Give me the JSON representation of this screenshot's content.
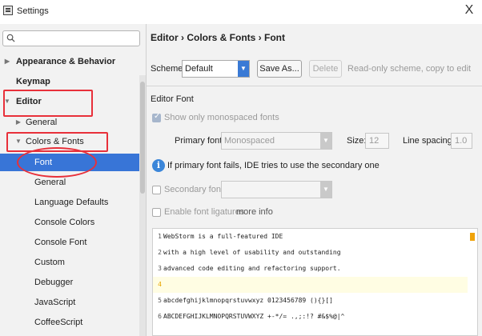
{
  "window": {
    "title": "Settings",
    "close_glyph": "X"
  },
  "search": {
    "placeholder": ""
  },
  "sidebar": {
    "items": [
      {
        "label": "Appearance & Behavior",
        "arrow": "▶"
      },
      {
        "label": "Keymap"
      },
      {
        "label": "Editor",
        "arrow": "▼"
      },
      {
        "label": "General",
        "arrow": "▶"
      },
      {
        "label": "Colors & Fonts",
        "arrow": "▼"
      },
      {
        "label": "Font"
      },
      {
        "label": "General"
      },
      {
        "label": "Language Defaults"
      },
      {
        "label": "Console Colors"
      },
      {
        "label": "Console Font"
      },
      {
        "label": "Custom"
      },
      {
        "label": "Debugger"
      },
      {
        "label": "JavaScript"
      },
      {
        "label": "CoffeeScript"
      }
    ]
  },
  "main": {
    "breadcrumb": "Editor › Colors & Fonts › Font",
    "scheme_label": "Scheme:",
    "scheme_value": "Default",
    "save_as_label": "Save As...",
    "delete_label": "Delete",
    "scheme_note": "Read-only scheme, copy to edit",
    "editor_font_title": "Editor Font",
    "show_mono_label": "Show only monospaced fonts",
    "primary_font_label": "Primary font:",
    "primary_font_value": "Monospaced",
    "size_label": "Size:",
    "size_value": "12",
    "line_spacing_label": "Line spacing:",
    "line_spacing_value": "1.0",
    "info_text": "If primary font fails, IDE tries to use the secondary one",
    "secondary_font_label": "Secondary font:",
    "ligatures_label": "Enable font ligatures",
    "more_info_label": "more info"
  },
  "preview": {
    "lines": [
      {
        "n": "1",
        "text": "WebStorm is a full-featured IDE"
      },
      {
        "n": "2",
        "text": "with a high level of usability and outstanding"
      },
      {
        "n": "3",
        "text": "advanced code editing and refactoring support."
      },
      {
        "n": "4",
        "text": ""
      },
      {
        "n": "5",
        "text": "abcdefghijklmnopqrstuvwxyz 0123456789 (){}[]"
      },
      {
        "n": "6",
        "text": "ABCDEFGHIJKLMNOPQRSTUVWXYZ +-*/= .,;:!? #&$%@|^"
      }
    ]
  },
  "colors": {
    "accent": "#3875d7",
    "annotation": "#e8303a",
    "gutter_marker": "#f0a30a"
  }
}
